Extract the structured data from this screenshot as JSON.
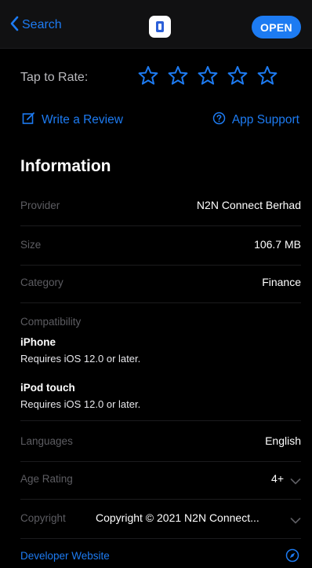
{
  "nav": {
    "back_label": "Search",
    "open_label": "OPEN"
  },
  "rating": {
    "label": "Tap to Rate:",
    "star_count": 5
  },
  "actions": {
    "write_review": "Write a Review",
    "app_support": "App Support"
  },
  "information": {
    "title": "Information",
    "provider": {
      "label": "Provider",
      "value": "N2N Connect Berhad"
    },
    "size": {
      "label": "Size",
      "value": "106.7 MB"
    },
    "category": {
      "label": "Category",
      "value": "Finance"
    },
    "compatibility": {
      "label": "Compatibility",
      "devices": [
        {
          "name": "iPhone",
          "requirement": "Requires iOS 12.0 or later."
        },
        {
          "name": "iPod touch",
          "requirement": "Requires iOS 12.0 or later."
        }
      ]
    },
    "languages": {
      "label": "Languages",
      "value": "English"
    },
    "age_rating": {
      "label": "Age Rating",
      "value": "4+"
    },
    "copyright": {
      "label": "Copyright",
      "value": "Copyright © 2021 N2N Connect..."
    },
    "developer_website": "Developer Website"
  },
  "colors": {
    "accent": "#1d7bf2",
    "background": "#000000",
    "muted_label": "#5d5d62"
  }
}
